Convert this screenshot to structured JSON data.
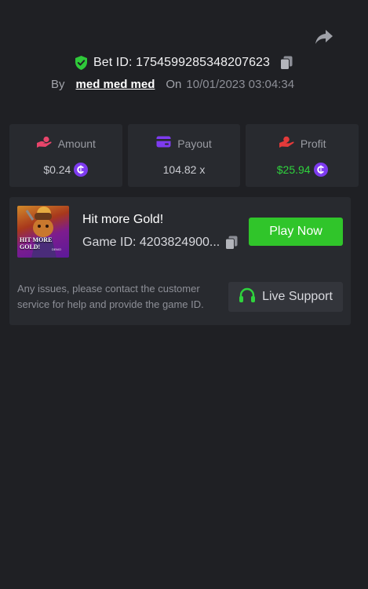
{
  "header": {
    "share_icon": "share-arrow-icon",
    "bet_id_label": "Bet ID: 1754599285348207623",
    "verified_icon": "shield-check-icon",
    "copy_icon": "copy-icon",
    "by_label": "By",
    "username": "med med med",
    "on_label": "On",
    "datetime": "10/01/2023 03:04:34"
  },
  "stats": [
    {
      "label": "Amount",
      "value": "$0.24",
      "icon": "hand-coin-icon",
      "icon_color": "#e8456b",
      "has_coin": true
    },
    {
      "label": "Payout",
      "value": "104.82 x",
      "icon": "card-icon",
      "icon_color": "#7e3bf0",
      "has_coin": false
    },
    {
      "label": "Profit",
      "value": "$25.94",
      "icon": "hand-profit-icon",
      "icon_color": "#e33a3a",
      "has_coin": true
    }
  ],
  "game": {
    "thumbnail_text_line1": "HIT MORE",
    "thumbnail_text_line2": "GOLD!",
    "thumbnail_text_small": "DEMO",
    "title": "Hit more Gold!",
    "game_id_label": "Game ID: 4203824900...",
    "play_button": "Play Now",
    "help_text": "Any issues, please contact the customer service for help and provide the game ID.",
    "support_button": "Live Support",
    "support_icon": "headset-icon"
  },
  "colors": {
    "background": "#1f2024",
    "card": "#282a2f",
    "accent_green": "#30c52a",
    "profit_green": "#2fd33d",
    "coin_purple": "#7e3bf0"
  }
}
